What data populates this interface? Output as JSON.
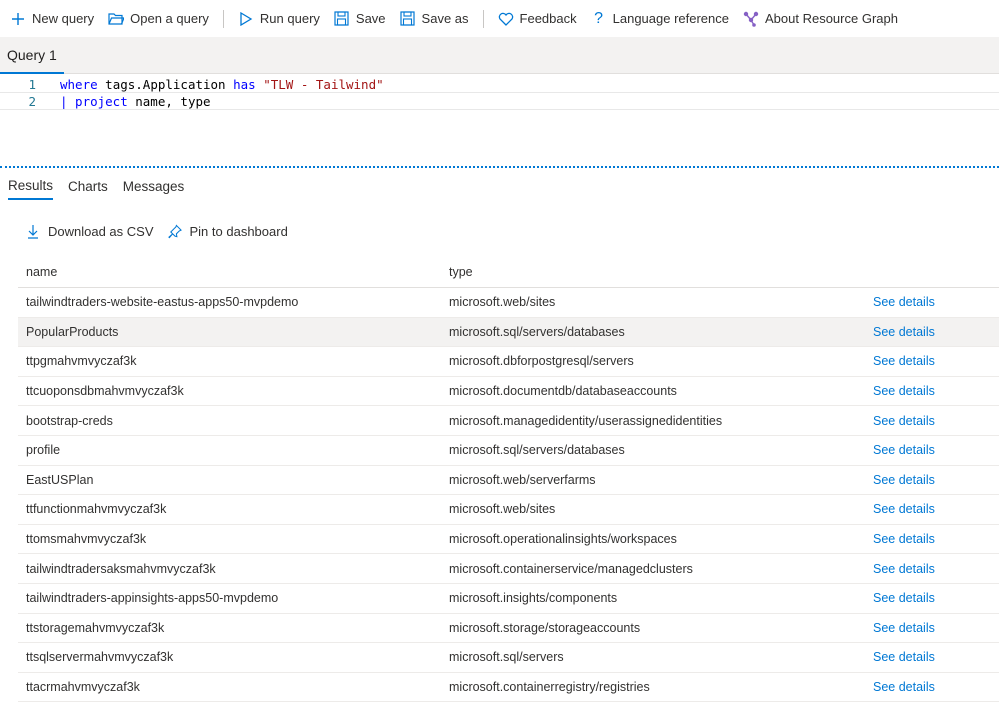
{
  "toolbar": {
    "new_query": "New query",
    "open_query": "Open a query",
    "run_query": "Run query",
    "save": "Save",
    "save_as": "Save as",
    "feedback": "Feedback",
    "language_reference": "Language reference",
    "about": "About Resource Graph"
  },
  "query_tab": {
    "label": "Query 1"
  },
  "editor": {
    "lines": [
      {
        "num": "1",
        "kw": "where",
        "text": " tags.Application ",
        "kw2": "has",
        "str": " \"TLW - Tailwind\""
      },
      {
        "num": "2",
        "kw": "| project",
        "text": " name, type"
      }
    ]
  },
  "result_tabs": [
    "Results",
    "Charts",
    "Messages"
  ],
  "actions": {
    "download": "Download as CSV",
    "pin": "Pin to dashboard"
  },
  "table": {
    "columns": [
      "name",
      "type"
    ],
    "details_label": "See details",
    "rows": [
      {
        "name": "tailwindtraders-website-eastus-apps50-mvpdemo",
        "type": "microsoft.web/sites"
      },
      {
        "name": "PopularProducts",
        "type": "microsoft.sql/servers/databases"
      },
      {
        "name": "ttpgmahvmvyczaf3k",
        "type": "microsoft.dbforpostgresql/servers"
      },
      {
        "name": "ttcuoponsdbmahvmvyczaf3k",
        "type": "microsoft.documentdb/databaseaccounts"
      },
      {
        "name": "bootstrap-creds",
        "type": "microsoft.managedidentity/userassignedidentities"
      },
      {
        "name": "profile",
        "type": "microsoft.sql/servers/databases"
      },
      {
        "name": "EastUSPlan",
        "type": "microsoft.web/serverfarms"
      },
      {
        "name": "ttfunctionmahvmvyczaf3k",
        "type": "microsoft.web/sites"
      },
      {
        "name": "ttomsmahvmvyczaf3k",
        "type": "microsoft.operationalinsights/workspaces"
      },
      {
        "name": "tailwindtradersaksmahvmvyczaf3k",
        "type": "microsoft.containerservice/managedclusters"
      },
      {
        "name": "tailwindtraders-appinsights-apps50-mvpdemo",
        "type": "microsoft.insights/components"
      },
      {
        "name": "ttstoragemahvmvyczaf3k",
        "type": "microsoft.storage/storageaccounts"
      },
      {
        "name": "ttsqlservermahvmvyczaf3k",
        "type": "microsoft.sql/servers"
      },
      {
        "name": "ttacrmahvmvyczaf3k",
        "type": "microsoft.containerregistry/registries"
      }
    ]
  },
  "colors": {
    "accent": "#0078d4",
    "feedback_icon": "#0078d4",
    "about_icon": "#8661c5"
  }
}
